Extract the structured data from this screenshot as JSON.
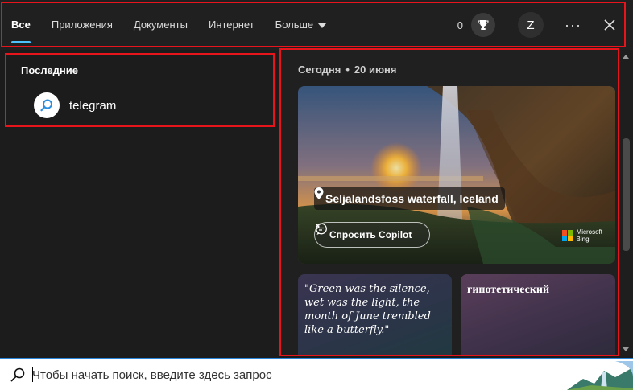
{
  "nav": {
    "tabs": [
      {
        "label": "Все"
      },
      {
        "label": "Приложения"
      },
      {
        "label": "Документы"
      },
      {
        "label": "Интернет"
      },
      {
        "label": "Больше"
      }
    ],
    "active_tab": "Все",
    "points": "0",
    "avatar_letter": "Z",
    "more_label": "···"
  },
  "recent": {
    "title": "Последние",
    "items": [
      {
        "label": "telegram"
      }
    ]
  },
  "today": {
    "label": "Сегодня",
    "date": "20 июня",
    "hero": {
      "location": "Seljalandsfoss waterfall, Iceland",
      "copilot_button": "Спросить Copilot",
      "brand_line1": "Microsoft",
      "brand_line2": "Bing"
    },
    "quote_card": {
      "text": "\"Green was the silence, wet was the light, the month of June trembled like a butterfly.\""
    },
    "word_card": {
      "text": "гипотетический"
    }
  },
  "search": {
    "placeholder": "Чтобы начать поиск, введите здесь запрос"
  },
  "colors": {
    "accent": "#4cc2ff",
    "highlight_box": "#e8141c",
    "background": "#1c1c1c"
  },
  "icons": {
    "trophy": "trophy-icon",
    "close": "close-icon",
    "recent_search": "search-icon",
    "location": "location-pin-icon",
    "copilot": "chat-bubble-icon",
    "search_bar": "search-icon"
  }
}
